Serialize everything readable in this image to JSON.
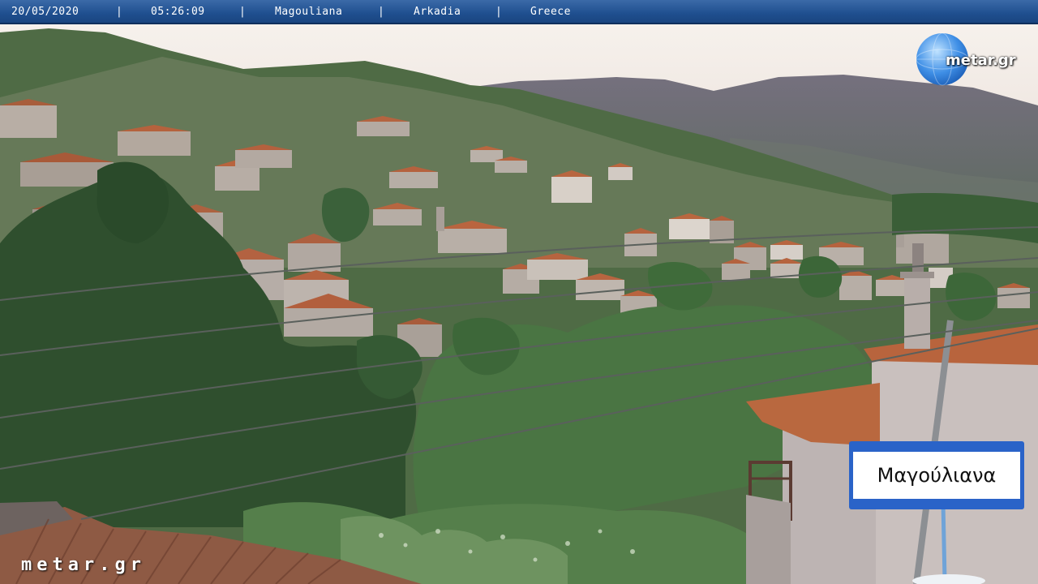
{
  "overlay": {
    "date": "20/05/2020",
    "time": "05:26:09",
    "village": "Magouliana",
    "region": "Arkadia",
    "country": "Greece",
    "separator": "|"
  },
  "logo": {
    "text": "metar.gr"
  },
  "watermark": {
    "text": "metar.gr"
  },
  "sign": {
    "text": "Μαγούλιανα"
  },
  "colors": {
    "bar": "#1f4f8f",
    "sky": "#f2ece6",
    "foliage": "#3f6a3a",
    "roof": "#b9673f",
    "sign_blue": "#1d5fd6"
  }
}
